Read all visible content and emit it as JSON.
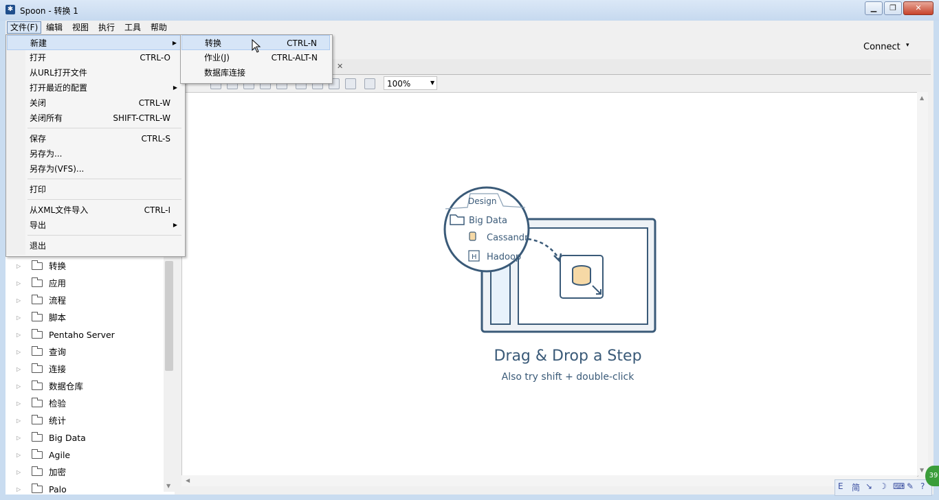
{
  "window": {
    "title": "Spoon - 转换 1",
    "app_icon": "spoon-icon"
  },
  "menubar": {
    "items": [
      "文件(F)",
      "编辑",
      "视图",
      "执行",
      "工具",
      "帮助"
    ]
  },
  "toolbar": {
    "connect_label": "Connect",
    "connect_caret": "▾"
  },
  "file_menu": {
    "items": [
      {
        "label": "新建",
        "shortcut": "",
        "submenu": true
      },
      {
        "label": "打开",
        "shortcut": "CTRL-O",
        "submenu": false
      },
      {
        "label": "从URL打开文件",
        "shortcut": "",
        "submenu": false
      },
      {
        "label": "打开最近的配置",
        "shortcut": "",
        "submenu": true
      },
      {
        "label": "关闭",
        "shortcut": "CTRL-W",
        "submenu": false
      },
      {
        "label": "关闭所有",
        "shortcut": "SHIFT-CTRL-W",
        "submenu": false
      },
      {
        "label": "保存",
        "shortcut": "CTRL-S",
        "submenu": false
      },
      {
        "label": "另存为...",
        "shortcut": "",
        "submenu": false
      },
      {
        "label": "另存为(VFS)...",
        "shortcut": "",
        "submenu": false
      },
      {
        "label": "打印",
        "shortcut": "",
        "submenu": false
      },
      {
        "label": "从XML文件导入",
        "shortcut": "CTRL-I",
        "submenu": false
      },
      {
        "label": "导出",
        "shortcut": "",
        "submenu": true
      },
      {
        "label": "退出",
        "shortcut": "",
        "submenu": false
      }
    ]
  },
  "new_submenu": {
    "items": [
      {
        "label": "转换",
        "shortcut": "CTRL-N"
      },
      {
        "label": "作业(J)",
        "shortcut": "CTRL-ALT-N"
      },
      {
        "label": "数据库连接",
        "shortcut": ""
      }
    ]
  },
  "canvas": {
    "zoom": "100%",
    "tab_close": "✕",
    "illustration": {
      "tab_label": "Design",
      "tree_items": [
        "Big Data",
        "Cassandr",
        "Hadoop"
      ],
      "hadoop_badge": "H"
    },
    "title": "Drag & Drop a Step",
    "subtitle": "Also try shift + double-click"
  },
  "tree": {
    "items": [
      "转换",
      "应用",
      "流程",
      "脚本",
      "Pentaho Server",
      "查询",
      "连接",
      "数据仓库",
      "检验",
      "统计",
      "Big Data",
      "Agile",
      "加密",
      "Palo"
    ]
  },
  "ime": {
    "badge": "39",
    "glyphs": [
      "E",
      "简",
      "↘",
      "☽",
      "⌨",
      "✎",
      "?"
    ]
  },
  "colors": {
    "accent": "#3a5a78",
    "menu_highlight": "#d6e5f7",
    "titlebar": "#c6d9ef"
  }
}
